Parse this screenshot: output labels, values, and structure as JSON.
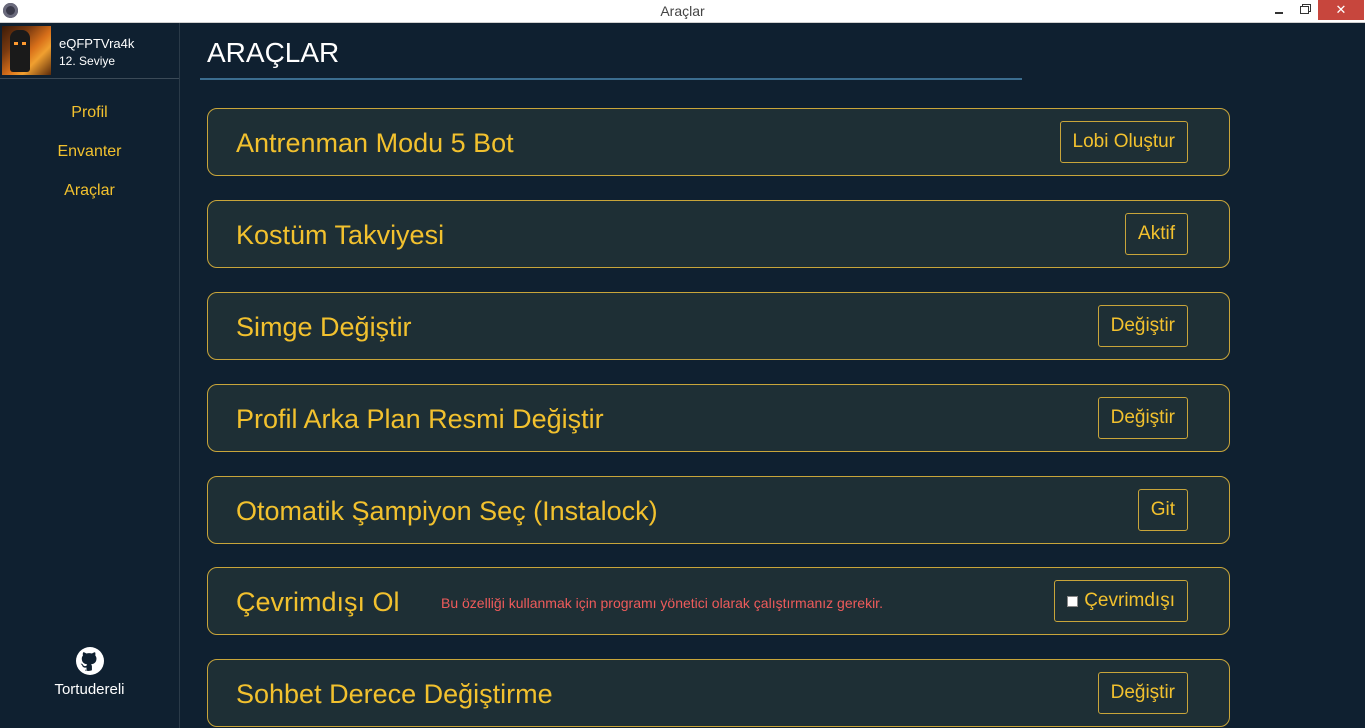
{
  "window": {
    "title": "Araçlar",
    "min_glyph": "",
    "close_glyph": "✕"
  },
  "sidebar": {
    "username": "eQFPTVra4k",
    "level": "12. Seviye",
    "nav": [
      {
        "label": "Profil"
      },
      {
        "label": "Envanter"
      },
      {
        "label": "Araçlar"
      }
    ],
    "github_label": "Tortudereli"
  },
  "main": {
    "title": "ARAÇLAR",
    "tools": [
      {
        "label": "Antrenman Modu 5 Bot",
        "button": "Lobi Oluştur"
      },
      {
        "label": "Kostüm Takviyesi",
        "button": "Aktif"
      },
      {
        "label": "Simge Değiştir",
        "button": "Değiştir"
      },
      {
        "label": "Profil Arka Plan Resmi Değiştir",
        "button": "Değiştir"
      },
      {
        "label": "Otomatik Şampiyon Seç (Instalock)",
        "button": "Git"
      },
      {
        "label": "Çevrimdışı Ol",
        "note": "Bu özelliği kullanmak için programı yönetici olarak çalıştırmanız gerekir.",
        "button": "Çevrimdışı",
        "checked": false
      },
      {
        "label": "Sohbet Derece Değiştirme",
        "button": "Değiştir"
      }
    ]
  },
  "colors": {
    "background": "#0f2030",
    "card_background": "#1e2f35",
    "accent": "#f2c12e",
    "card_border": "#c8a53a",
    "warning_text": "#ee5b5b",
    "title_rule": "#3b6d8f",
    "close_button": "#c7463d"
  }
}
